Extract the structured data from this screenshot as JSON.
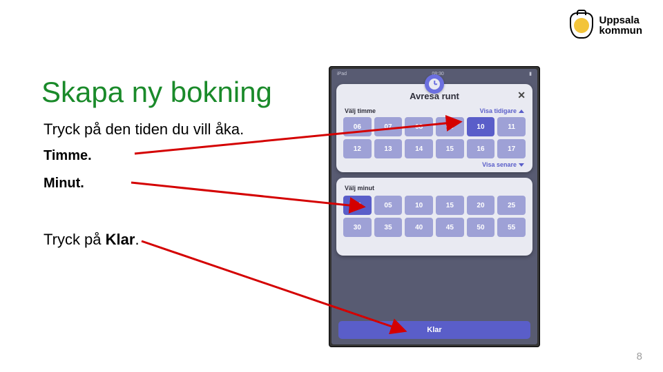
{
  "logo": {
    "line1": "Uppsala",
    "line2": "kommun"
  },
  "title": "Skapa ny bokning",
  "lines": {
    "intro": "Tryck på den tiden du vill åka.",
    "hour": "Timme.",
    "minute": "Minut.",
    "done_pre": "Tryck på ",
    "done_bold": "Klar",
    "done_post": "."
  },
  "pagenum": "8",
  "phone": {
    "status_left": "iPad",
    "time": "08:30",
    "title": "Avresa runt",
    "close": "✕",
    "hour_label": "Välj timme",
    "earlier": "Visa tidigare",
    "later": "Visa senare",
    "hours": [
      "06",
      "07",
      "08",
      "09",
      "10",
      "11",
      "12",
      "13",
      "14",
      "15",
      "16",
      "17"
    ],
    "hour_selected": "10",
    "min_label": "Välj minut",
    "minutes": [
      "00",
      "05",
      "10",
      "15",
      "20",
      "25",
      "30",
      "35",
      "40",
      "45",
      "50",
      "55"
    ],
    "min_selected": "00",
    "done": "Klar"
  }
}
